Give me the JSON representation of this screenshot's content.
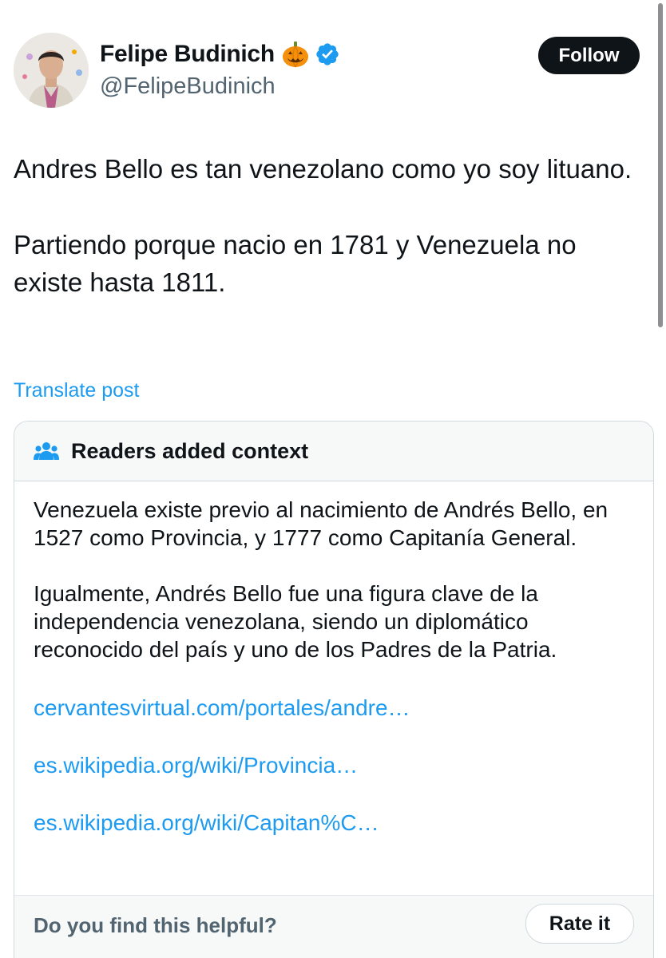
{
  "author": {
    "display_name": "Felipe Budinich",
    "handle": "@FelipeBudinich",
    "emoji_icon": "jack-o-lantern-icon",
    "verified_icon": "verified-badge-icon",
    "verified_color": "#1d9bf0",
    "follow_label": "Follow"
  },
  "post": {
    "paragraphs": [
      "Andres Bello es tan venezolano como yo soy lituano.",
      "Partiendo porque nacio en 1781 y Venezuela no existe hasta 1811."
    ],
    "translate_label": "Translate post"
  },
  "community_note": {
    "icon": "people-icon",
    "title": "Readers added context",
    "paragraphs": [
      "Venezuela existe previo al nacimiento de Andrés Bello, en 1527 como Provincia, y 1777 como Capitanía General.",
      "Igualmente, Andrés Bello fue una figura clave de la independencia venezolana, siendo un diplomático reconocido del país y uno de los Padres de la Patria."
    ],
    "links": [
      "cervantesvirtual.com/portales/andre…",
      "es.wikipedia.org/wiki/Provincia…",
      "es.wikipedia.org/wiki/Capitan%C…"
    ],
    "helpful_prompt": "Do you find this helpful?",
    "rate_label": "Rate it"
  },
  "colors": {
    "link": "#1d9bf0",
    "text": "#0f1419",
    "muted": "#536471",
    "border": "#cfd9de",
    "header_bg": "#f7f9f9"
  }
}
